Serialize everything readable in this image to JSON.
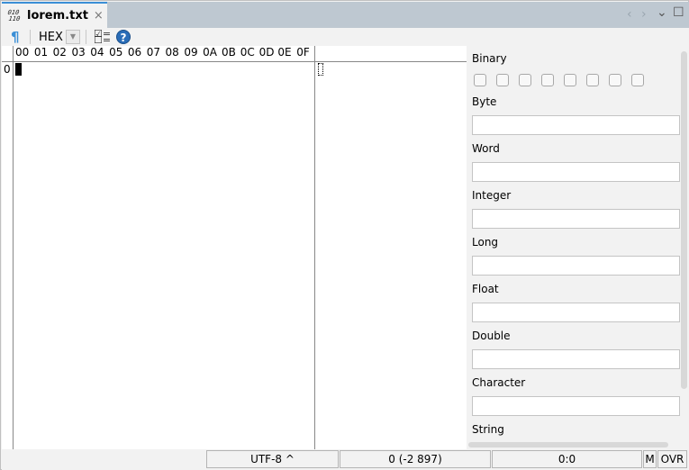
{
  "tab": {
    "icon": "binary-file-icon",
    "icon_text": [
      "010",
      "110"
    ],
    "title": "lorem.txt",
    "close": "×"
  },
  "window_controls": {
    "back": "‹",
    "forward": "›",
    "menu": "⌄",
    "maximize": "☐"
  },
  "toolbar": {
    "show_whitespace": "¶",
    "code_type": "HEX",
    "dropdown_arrow": "▼",
    "help": "?"
  },
  "editor": {
    "column_headers": [
      "00",
      "01",
      "02",
      "03",
      "04",
      "05",
      "06",
      "07",
      "08",
      "09",
      "0A",
      "0B",
      "0C",
      "0D",
      "0E",
      "0F"
    ],
    "row_address": "0"
  },
  "values_panel": {
    "binary_label": "Binary",
    "bit_count": 8,
    "fields": [
      {
        "label": "Byte",
        "value": ""
      },
      {
        "label": "Word",
        "value": ""
      },
      {
        "label": "Integer",
        "value": ""
      },
      {
        "label": "Long",
        "value": ""
      },
      {
        "label": "Float",
        "value": ""
      },
      {
        "label": "Double",
        "value": ""
      },
      {
        "label": "Character",
        "value": ""
      }
    ],
    "string_label": "String"
  },
  "statusbar": {
    "encoding": "UTF-8 ^",
    "position": "0 (-2 897)",
    "cursor": "0:0",
    "mode": "M",
    "insert_mode": "OVR"
  }
}
